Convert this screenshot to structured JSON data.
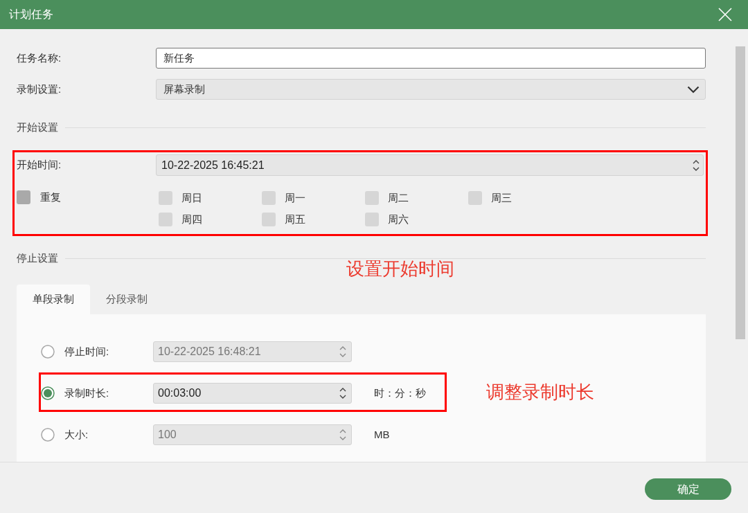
{
  "window": {
    "title": "计划任务"
  },
  "form": {
    "task_name": {
      "label": "任务名称:",
      "value": "新任务"
    },
    "recording": {
      "label": "录制设置:",
      "value": "屏幕录制"
    }
  },
  "start_settings": {
    "heading": "开始设置",
    "highlighted": true,
    "start_time": {
      "label": "开始时间:",
      "value": "10-22-2025 16:45:21"
    },
    "repeat": {
      "label": "重复",
      "checked": false
    },
    "weekdays": [
      {
        "label": "周日",
        "checked": false,
        "disabled": true
      },
      {
        "label": "周一",
        "checked": false,
        "disabled": true
      },
      {
        "label": "周二",
        "checked": false,
        "disabled": true
      },
      {
        "label": "周三",
        "checked": false,
        "disabled": true
      },
      {
        "label": "周四",
        "checked": false,
        "disabled": true
      },
      {
        "label": "周五",
        "checked": false,
        "disabled": true
      },
      {
        "label": "周六",
        "checked": false,
        "disabled": true
      }
    ]
  },
  "stop_settings": {
    "heading": "停止设置",
    "tabs": [
      {
        "label": "单段录制",
        "selected": true
      },
      {
        "label": "分段录制",
        "selected": false
      }
    ],
    "options": [
      {
        "label": "停止时间:",
        "value": "10-22-2025 16:48:21",
        "selected": false,
        "highlighted": false
      },
      {
        "label": "录制时长:",
        "value": "00:03:00",
        "unit": "时：分：秒",
        "selected": true,
        "highlighted": true
      },
      {
        "label": "大小:",
        "value": "100",
        "unit": "MB",
        "selected": false,
        "highlighted": false
      }
    ]
  },
  "annotations": [
    "设置开始时间",
    "调整录制时长"
  ],
  "buttons": [
    {
      "label": "确定"
    }
  ]
}
